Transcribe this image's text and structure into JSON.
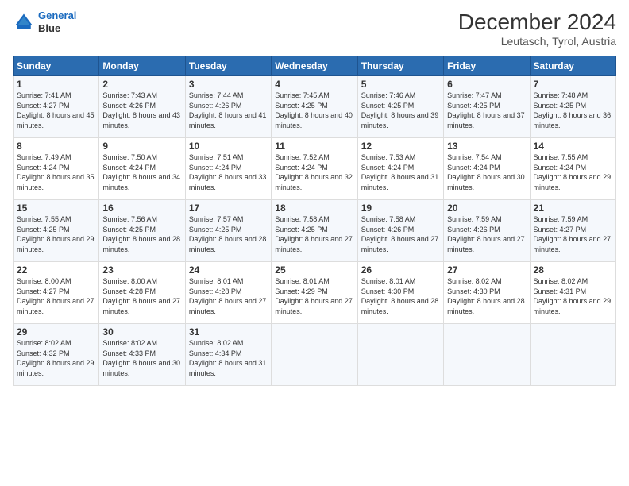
{
  "header": {
    "logo_line1": "General",
    "logo_line2": "Blue",
    "title": "December 2024",
    "location": "Leutasch, Tyrol, Austria"
  },
  "days_of_week": [
    "Sunday",
    "Monday",
    "Tuesday",
    "Wednesday",
    "Thursday",
    "Friday",
    "Saturday"
  ],
  "weeks": [
    [
      {
        "day": "1",
        "sunrise": "Sunrise: 7:41 AM",
        "sunset": "Sunset: 4:27 PM",
        "daylight": "Daylight: 8 hours and 45 minutes."
      },
      {
        "day": "2",
        "sunrise": "Sunrise: 7:43 AM",
        "sunset": "Sunset: 4:26 PM",
        "daylight": "Daylight: 8 hours and 43 minutes."
      },
      {
        "day": "3",
        "sunrise": "Sunrise: 7:44 AM",
        "sunset": "Sunset: 4:26 PM",
        "daylight": "Daylight: 8 hours and 41 minutes."
      },
      {
        "day": "4",
        "sunrise": "Sunrise: 7:45 AM",
        "sunset": "Sunset: 4:25 PM",
        "daylight": "Daylight: 8 hours and 40 minutes."
      },
      {
        "day": "5",
        "sunrise": "Sunrise: 7:46 AM",
        "sunset": "Sunset: 4:25 PM",
        "daylight": "Daylight: 8 hours and 39 minutes."
      },
      {
        "day": "6",
        "sunrise": "Sunrise: 7:47 AM",
        "sunset": "Sunset: 4:25 PM",
        "daylight": "Daylight: 8 hours and 37 minutes."
      },
      {
        "day": "7",
        "sunrise": "Sunrise: 7:48 AM",
        "sunset": "Sunset: 4:25 PM",
        "daylight": "Daylight: 8 hours and 36 minutes."
      }
    ],
    [
      {
        "day": "8",
        "sunrise": "Sunrise: 7:49 AM",
        "sunset": "Sunset: 4:24 PM",
        "daylight": "Daylight: 8 hours and 35 minutes."
      },
      {
        "day": "9",
        "sunrise": "Sunrise: 7:50 AM",
        "sunset": "Sunset: 4:24 PM",
        "daylight": "Daylight: 8 hours and 34 minutes."
      },
      {
        "day": "10",
        "sunrise": "Sunrise: 7:51 AM",
        "sunset": "Sunset: 4:24 PM",
        "daylight": "Daylight: 8 hours and 33 minutes."
      },
      {
        "day": "11",
        "sunrise": "Sunrise: 7:52 AM",
        "sunset": "Sunset: 4:24 PM",
        "daylight": "Daylight: 8 hours and 32 minutes."
      },
      {
        "day": "12",
        "sunrise": "Sunrise: 7:53 AM",
        "sunset": "Sunset: 4:24 PM",
        "daylight": "Daylight: 8 hours and 31 minutes."
      },
      {
        "day": "13",
        "sunrise": "Sunrise: 7:54 AM",
        "sunset": "Sunset: 4:24 PM",
        "daylight": "Daylight: 8 hours and 30 minutes."
      },
      {
        "day": "14",
        "sunrise": "Sunrise: 7:55 AM",
        "sunset": "Sunset: 4:24 PM",
        "daylight": "Daylight: 8 hours and 29 minutes."
      }
    ],
    [
      {
        "day": "15",
        "sunrise": "Sunrise: 7:55 AM",
        "sunset": "Sunset: 4:25 PM",
        "daylight": "Daylight: 8 hours and 29 minutes."
      },
      {
        "day": "16",
        "sunrise": "Sunrise: 7:56 AM",
        "sunset": "Sunset: 4:25 PM",
        "daylight": "Daylight: 8 hours and 28 minutes."
      },
      {
        "day": "17",
        "sunrise": "Sunrise: 7:57 AM",
        "sunset": "Sunset: 4:25 PM",
        "daylight": "Daylight: 8 hours and 28 minutes."
      },
      {
        "day": "18",
        "sunrise": "Sunrise: 7:58 AM",
        "sunset": "Sunset: 4:25 PM",
        "daylight": "Daylight: 8 hours and 27 minutes."
      },
      {
        "day": "19",
        "sunrise": "Sunrise: 7:58 AM",
        "sunset": "Sunset: 4:26 PM",
        "daylight": "Daylight: 8 hours and 27 minutes."
      },
      {
        "day": "20",
        "sunrise": "Sunrise: 7:59 AM",
        "sunset": "Sunset: 4:26 PM",
        "daylight": "Daylight: 8 hours and 27 minutes."
      },
      {
        "day": "21",
        "sunrise": "Sunrise: 7:59 AM",
        "sunset": "Sunset: 4:27 PM",
        "daylight": "Daylight: 8 hours and 27 minutes."
      }
    ],
    [
      {
        "day": "22",
        "sunrise": "Sunrise: 8:00 AM",
        "sunset": "Sunset: 4:27 PM",
        "daylight": "Daylight: 8 hours and 27 minutes."
      },
      {
        "day": "23",
        "sunrise": "Sunrise: 8:00 AM",
        "sunset": "Sunset: 4:28 PM",
        "daylight": "Daylight: 8 hours and 27 minutes."
      },
      {
        "day": "24",
        "sunrise": "Sunrise: 8:01 AM",
        "sunset": "Sunset: 4:28 PM",
        "daylight": "Daylight: 8 hours and 27 minutes."
      },
      {
        "day": "25",
        "sunrise": "Sunrise: 8:01 AM",
        "sunset": "Sunset: 4:29 PM",
        "daylight": "Daylight: 8 hours and 27 minutes."
      },
      {
        "day": "26",
        "sunrise": "Sunrise: 8:01 AM",
        "sunset": "Sunset: 4:30 PM",
        "daylight": "Daylight: 8 hours and 28 minutes."
      },
      {
        "day": "27",
        "sunrise": "Sunrise: 8:02 AM",
        "sunset": "Sunset: 4:30 PM",
        "daylight": "Daylight: 8 hours and 28 minutes."
      },
      {
        "day": "28",
        "sunrise": "Sunrise: 8:02 AM",
        "sunset": "Sunset: 4:31 PM",
        "daylight": "Daylight: 8 hours and 29 minutes."
      }
    ],
    [
      {
        "day": "29",
        "sunrise": "Sunrise: 8:02 AM",
        "sunset": "Sunset: 4:32 PM",
        "daylight": "Daylight: 8 hours and 29 minutes."
      },
      {
        "day": "30",
        "sunrise": "Sunrise: 8:02 AM",
        "sunset": "Sunset: 4:33 PM",
        "daylight": "Daylight: 8 hours and 30 minutes."
      },
      {
        "day": "31",
        "sunrise": "Sunrise: 8:02 AM",
        "sunset": "Sunset: 4:34 PM",
        "daylight": "Daylight: 8 hours and 31 minutes."
      },
      {
        "day": "",
        "sunrise": "",
        "sunset": "",
        "daylight": ""
      },
      {
        "day": "",
        "sunrise": "",
        "sunset": "",
        "daylight": ""
      },
      {
        "day": "",
        "sunrise": "",
        "sunset": "",
        "daylight": ""
      },
      {
        "day": "",
        "sunrise": "",
        "sunset": "",
        "daylight": ""
      }
    ]
  ]
}
